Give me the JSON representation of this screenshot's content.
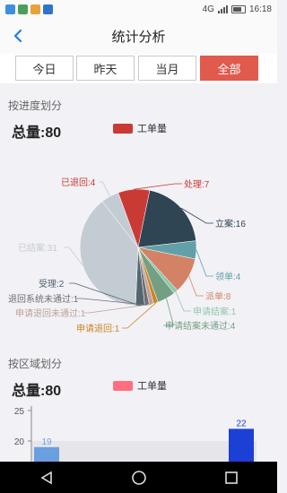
{
  "status": {
    "network": "4G",
    "time": "16:18"
  },
  "header": {
    "title": "统计分析"
  },
  "tabs": [
    {
      "label": "今日",
      "active": false
    },
    {
      "label": "昨天",
      "active": false
    },
    {
      "label": "当月",
      "active": false
    },
    {
      "label": "全部",
      "active": true
    }
  ],
  "progress_section": {
    "title": "按进度划分",
    "total_label": "总量:80",
    "legend": "工单量",
    "legend_color": "#c93a35"
  },
  "region_section": {
    "title": "按区域划分",
    "total_label": "总量:80",
    "legend": "工单量",
    "legend_color": "#ff6f7f"
  },
  "chart_data": [
    {
      "type": "pie",
      "title": "",
      "slices": [
        {
          "label": "处理:7",
          "value": 7,
          "color": "#c93a35"
        },
        {
          "label": "立案:16",
          "value": 16,
          "color": "#2f4554"
        },
        {
          "label": "领单:4",
          "value": 4,
          "color": "#61a0a8"
        },
        {
          "label": "派单:8",
          "value": 8,
          "color": "#d48265"
        },
        {
          "label": "申请结案:1",
          "value": 1,
          "color": "#91c7ae"
        },
        {
          "label": "申请结案未通过:4",
          "value": 4,
          "color": "#749f83"
        },
        {
          "label": "申请退回:1",
          "value": 1,
          "color": "#ca8622"
        },
        {
          "label": "申请退回未通过:1",
          "value": 1,
          "color": "#bda29a"
        },
        {
          "label": "退回系统未通过:1",
          "value": 1,
          "color": "#6e7074"
        },
        {
          "label": "受理:2",
          "value": 2,
          "color": "#546570"
        },
        {
          "label": "已结案:31",
          "value": 31,
          "color": "#c4ccd3"
        },
        {
          "label": "已退回:4",
          "value": 4,
          "color": "#c4ccd3"
        }
      ]
    },
    {
      "type": "bar",
      "series": [
        {
          "values": [
            19,
            22
          ]
        }
      ],
      "bar_colors": [
        "#6a9fe0",
        "#1c3fd6"
      ],
      "ylim": [
        0,
        25
      ],
      "yticks": [
        "25",
        "20"
      ]
    }
  ]
}
